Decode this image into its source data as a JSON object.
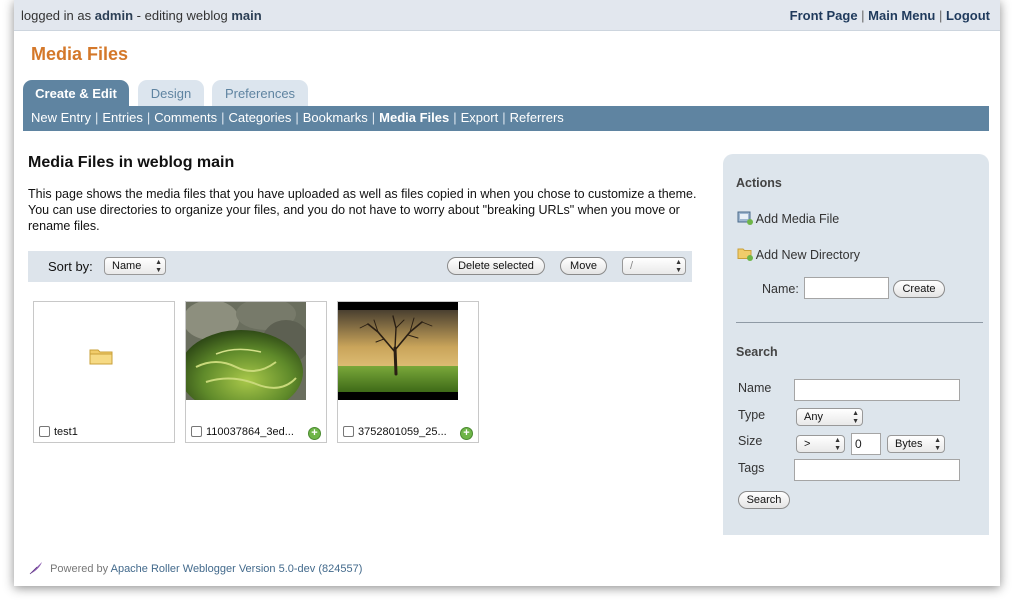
{
  "header": {
    "logged_prefix": "logged in as",
    "username": "admin",
    "editing_prefix": "- editing weblog",
    "weblog": "main",
    "links": [
      "Front Page",
      "Main Menu",
      "Logout"
    ]
  },
  "page_title": "Media Files",
  "tabs": [
    {
      "label": "Create & Edit",
      "active": true
    },
    {
      "label": "Design",
      "active": false
    },
    {
      "label": "Preferences",
      "active": false
    }
  ],
  "subnav": [
    "New Entry",
    "Entries",
    "Comments",
    "Categories",
    "Bookmarks",
    "Media Files",
    "Export",
    "Referrers"
  ],
  "subnav_current": "Media Files",
  "main": {
    "heading": "Media Files in weblog main",
    "description": "This page shows the media files that you have uploaded as well as files copied in when you chose to customize a theme. You can use directories to organize your files, and you do not have to worry about \"breaking URLs\" when you move or rename files."
  },
  "toolbar": {
    "sort_label": "Sort by:",
    "sort_value": "Name",
    "delete_label": "Delete selected",
    "move_label": "Move",
    "dir_value": "/"
  },
  "files": [
    {
      "name": "test1",
      "kind": "folder",
      "icon": "folder-icon"
    },
    {
      "name": "110037864_3ed...",
      "kind": "image",
      "icon": "watermelon-thumbnail"
    },
    {
      "name": "3752801059_25...",
      "kind": "image",
      "icon": "tree-thumbnail"
    }
  ],
  "sidebar": {
    "actions_heading": "Actions",
    "add_media_label": "Add Media File",
    "add_dir_label": "Add New Directory",
    "name_label": "Name:",
    "create_label": "Create",
    "search_heading": "Search",
    "search_name_label": "Name",
    "type_label": "Type",
    "type_value": "Any",
    "size_label": "Size",
    "size_op": ">",
    "size_value": "0",
    "size_unit": "Bytes",
    "tags_label": "Tags",
    "search_button": "Search"
  },
  "footer": {
    "powered": "Powered by",
    "product": "Apache Roller Weblogger",
    "version": "Version 5.0-dev (824557)"
  },
  "colors": {
    "accent_orange": "#d4782a",
    "nav_blue": "#5f84a1",
    "panel_gray": "#dde5ec"
  }
}
